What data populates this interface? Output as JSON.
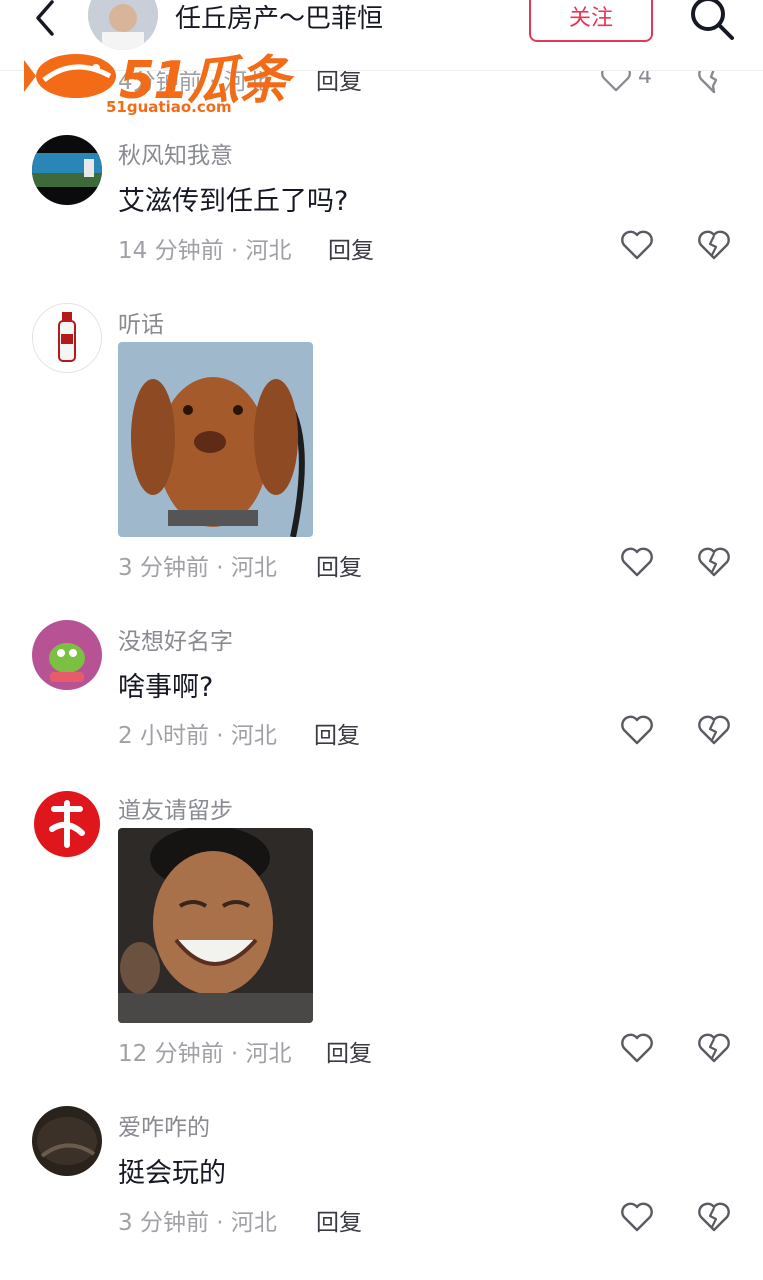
{
  "header": {
    "title": "任丘房产～巴菲恒",
    "follow_label": "关注"
  },
  "watermark": {
    "brand": "51瓜条",
    "url": "51guatiao.com"
  },
  "partial_row": {
    "meta": "4分钟前 · 河北",
    "reply_label": "回复",
    "like_count": "4"
  },
  "comments": [
    {
      "username": "秋风知我意",
      "text": "艾滋传到任丘了吗?",
      "meta": "14 分钟前 · 河北",
      "reply_label": "回复"
    },
    {
      "username": "听话",
      "meta": "3 分钟前 · 河北",
      "reply_label": "回复"
    },
    {
      "username": "没想好名字",
      "text": "啥事啊?",
      "meta": "2 小时前 · 河北",
      "reply_label": "回复"
    },
    {
      "username": "道友请留步",
      "meta": "12 分钟前 · 河北",
      "reply_label": "回复"
    },
    {
      "username": "爱咋咋的",
      "text": "挺会玩的",
      "meta": "3 分钟前 · 河北",
      "reply_label": "回复"
    }
  ],
  "colors": {
    "accent": "#e8365a",
    "watermark": "#f36b16",
    "secondary_text": "#a0a1a6"
  }
}
